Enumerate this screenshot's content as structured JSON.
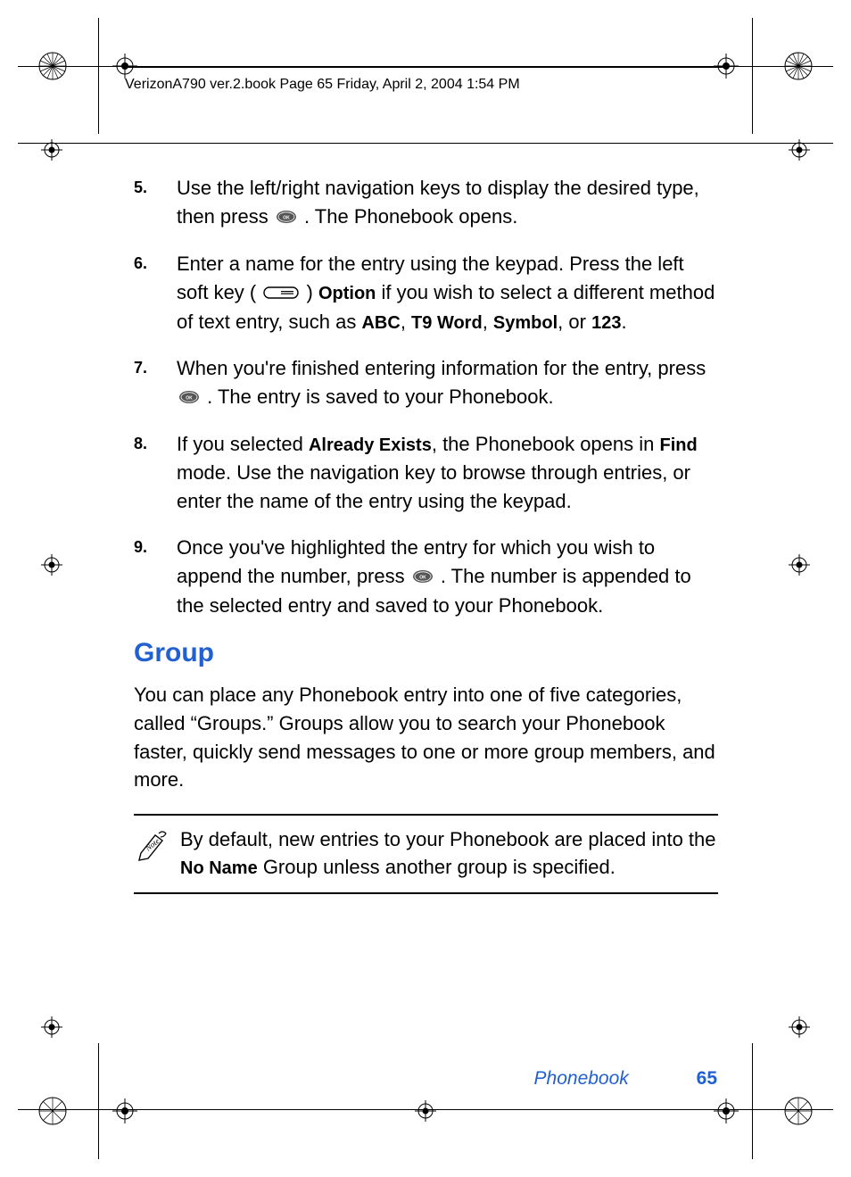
{
  "header": {
    "running_head": "VerizonA790 ver.2.book  Page 65  Friday, April 2, 2004  1:54 PM"
  },
  "steps": [
    {
      "num": "5.",
      "parts": {
        "t1": "Use the left/right navigation keys to display the desired type, then press ",
        "t2": ". The Phonebook opens."
      }
    },
    {
      "num": "6.",
      "parts": {
        "t1": "Enter a name for the entry using the keypad. Press the left soft key (",
        "t2": ") ",
        "b1": "Option",
        "t3": " if you wish to select a different method of text entry, such as ",
        "b2": "ABC",
        "t4": ", ",
        "b3": "T9 Word",
        "t5": ", ",
        "b4": "Symbol",
        "t6": ", or ",
        "b5": "123",
        "t7": "."
      }
    },
    {
      "num": "7.",
      "parts": {
        "t1": "When you're finished entering information for the entry, press ",
        "t2": ". The entry is saved to your Phonebook."
      }
    },
    {
      "num": "8.",
      "parts": {
        "t1": "If you selected ",
        "b1": "Already Exists",
        "t2": ", the Phonebook opens in ",
        "b2": "Find",
        "t3": " mode. Use the navigation key to browse through entries, or enter the name of the entry using the keypad."
      }
    },
    {
      "num": "9.",
      "parts": {
        "t1": "Once you've highlighted the entry for which you wish to append the number, press ",
        "t2": ". The number is appended to the selected entry and saved to your Phonebook."
      }
    }
  ],
  "section": {
    "heading": "Group",
    "intro": "You can place any Phonebook entry into one of five categories, called “Groups.” Groups allow you to search your Phonebook faster, quickly send messages to one or more group members, and more."
  },
  "note": {
    "t1": "By default, new entries to your Phonebook are placed into the ",
    "b1": "No Name",
    "t2": " Group unless another group is specified."
  },
  "footer": {
    "section_name": "Phonebook",
    "page_number": "65"
  },
  "icons": {
    "ok_button": "ok-button-icon",
    "softkey_button": "softkey-button-icon",
    "note": "note-icon",
    "crop_corner": "crop-corner-mark",
    "reg_target": "registration-target"
  }
}
